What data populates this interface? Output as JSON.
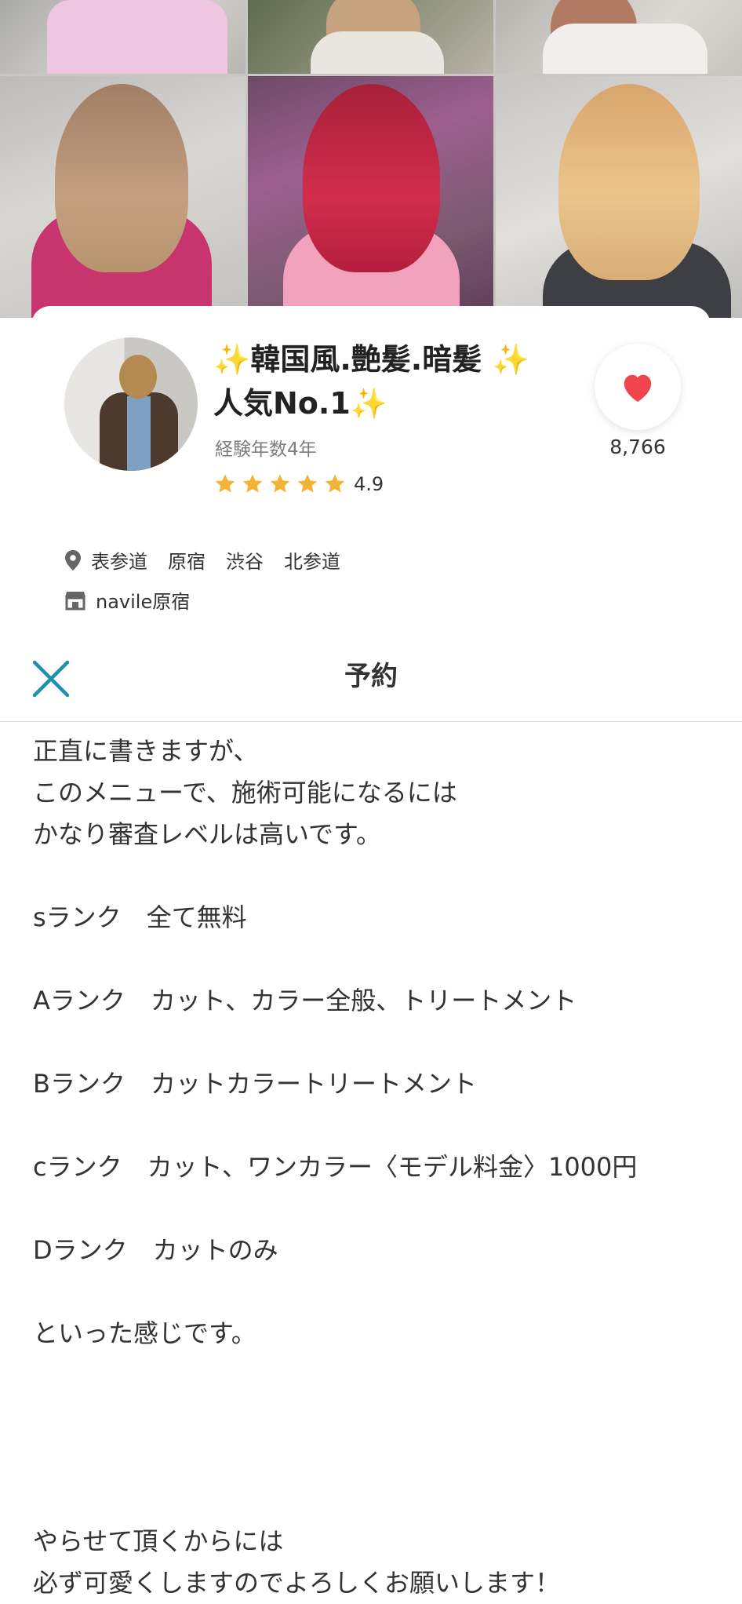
{
  "gallery": {
    "photos": [
      "hair-photo-1",
      "hair-photo-2",
      "hair-photo-3",
      "hair-photo-4",
      "hair-photo-5",
      "hair-photo-6"
    ]
  },
  "profile": {
    "title_line1": "韓国風.艶髪.暗髪",
    "title_line2": "人気No.1",
    "sparkle": "✨",
    "experience": "経験年数4年",
    "rating": "4.9",
    "stars_count": 5,
    "like_count": "8,766",
    "areas": [
      "表参道",
      "原宿",
      "渋谷",
      "北参道"
    ],
    "shop": "navile原宿"
  },
  "modal": {
    "title": "予約",
    "body_lines": [
      "正直に書きますが、",
      "このメニューで、施術可能になるには",
      "かなり審査レベルは高いです。",
      "",
      "sランク　全て無料",
      "",
      "Aランク　カット、カラー全般、トリートメント",
      "",
      "Bランク　カットカラートリートメント",
      "",
      "cランク　カット、ワンカラー〈モデル料金〉1000円",
      "",
      "Dランク　カットのみ",
      "",
      "といった感じです。",
      "",
      "",
      "",
      "",
      "やらせて頂くからには",
      "必ず可愛くしますのでよろしくお願いします！"
    ]
  },
  "colors": {
    "accent": "#1f8fb0",
    "heart": "#f0444f",
    "star": "#f5b335",
    "text": "#333333",
    "subtext": "#7d7d7d"
  }
}
